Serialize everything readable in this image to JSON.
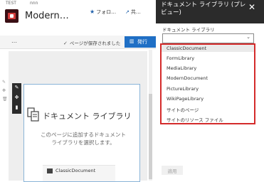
{
  "top_strip": {
    "left": "TEST",
    "right": "nnn"
  },
  "site": {
    "title": "Modern…",
    "follow_label": "フォロ…",
    "share_label": "共…"
  },
  "command_bar": {
    "more": "…",
    "saved_status": "ページが保存されました",
    "publish_label": "発行"
  },
  "webpart": {
    "title": "ドキュメント ライブラリ",
    "description": "このページに追加するドキュメント ライブラリを選択します。",
    "picker_item": "ClassicDocument"
  },
  "pane": {
    "title": "ドキュメント ライブラリ (プレビュー)",
    "field_label": "ドキュメント ライブラリ",
    "selected_value": "",
    "options": [
      "ClassicDocument",
      "FormLibrary",
      "MediaLibrary",
      "ModernDocument",
      "PictureLibrary",
      "WikiPageLibrary",
      "サイトのページ",
      "サイトのリソース ファイル"
    ],
    "apply_label": "適用"
  },
  "colors": {
    "accent": "#1f6fc5",
    "pane_header": "#2b2b2b",
    "highlight_border": "#d42b2b"
  }
}
